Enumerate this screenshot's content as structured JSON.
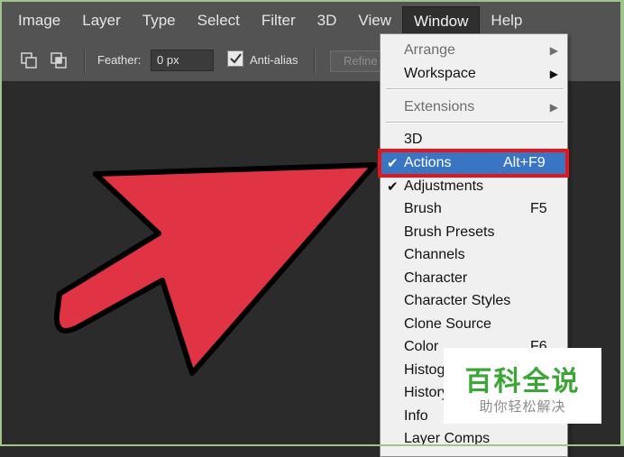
{
  "menubar": {
    "items": [
      "Image",
      "Layer",
      "Type",
      "Select",
      "Filter",
      "3D",
      "View",
      "Window",
      "Help"
    ]
  },
  "options": {
    "feather_label": "Feather:",
    "feather_value": "0 px",
    "antialias_label": "Anti-alias",
    "antialias_checked": true,
    "refine_label": "Refine"
  },
  "window_menu": {
    "items": [
      {
        "label": "Arrange",
        "submenu": true,
        "disabled": true
      },
      {
        "label": "Workspace",
        "submenu": true
      },
      {
        "label": "Extensions",
        "submenu": true,
        "disabled": true
      },
      {
        "label": "3D"
      },
      {
        "label": "Actions",
        "shortcut": "Alt+F9",
        "checked": true,
        "highlighted": true
      },
      {
        "label": "Adjustments",
        "checked": true
      },
      {
        "label": "Brush",
        "shortcut": "F5"
      },
      {
        "label": "Brush Presets"
      },
      {
        "label": "Channels"
      },
      {
        "label": "Character"
      },
      {
        "label": "Character Styles"
      },
      {
        "label": "Clone Source"
      },
      {
        "label": "Color",
        "shortcut": "F6"
      },
      {
        "label": "Histogram"
      },
      {
        "label": "History"
      },
      {
        "label": "Info"
      },
      {
        "label": "Layer Comps"
      }
    ]
  },
  "colors": {
    "arrow": "#e03445",
    "highlight": "#3a75c4",
    "callout": "#e4151d"
  },
  "watermark": {
    "title": "百科全说",
    "subtitle": "助你轻松解决"
  }
}
